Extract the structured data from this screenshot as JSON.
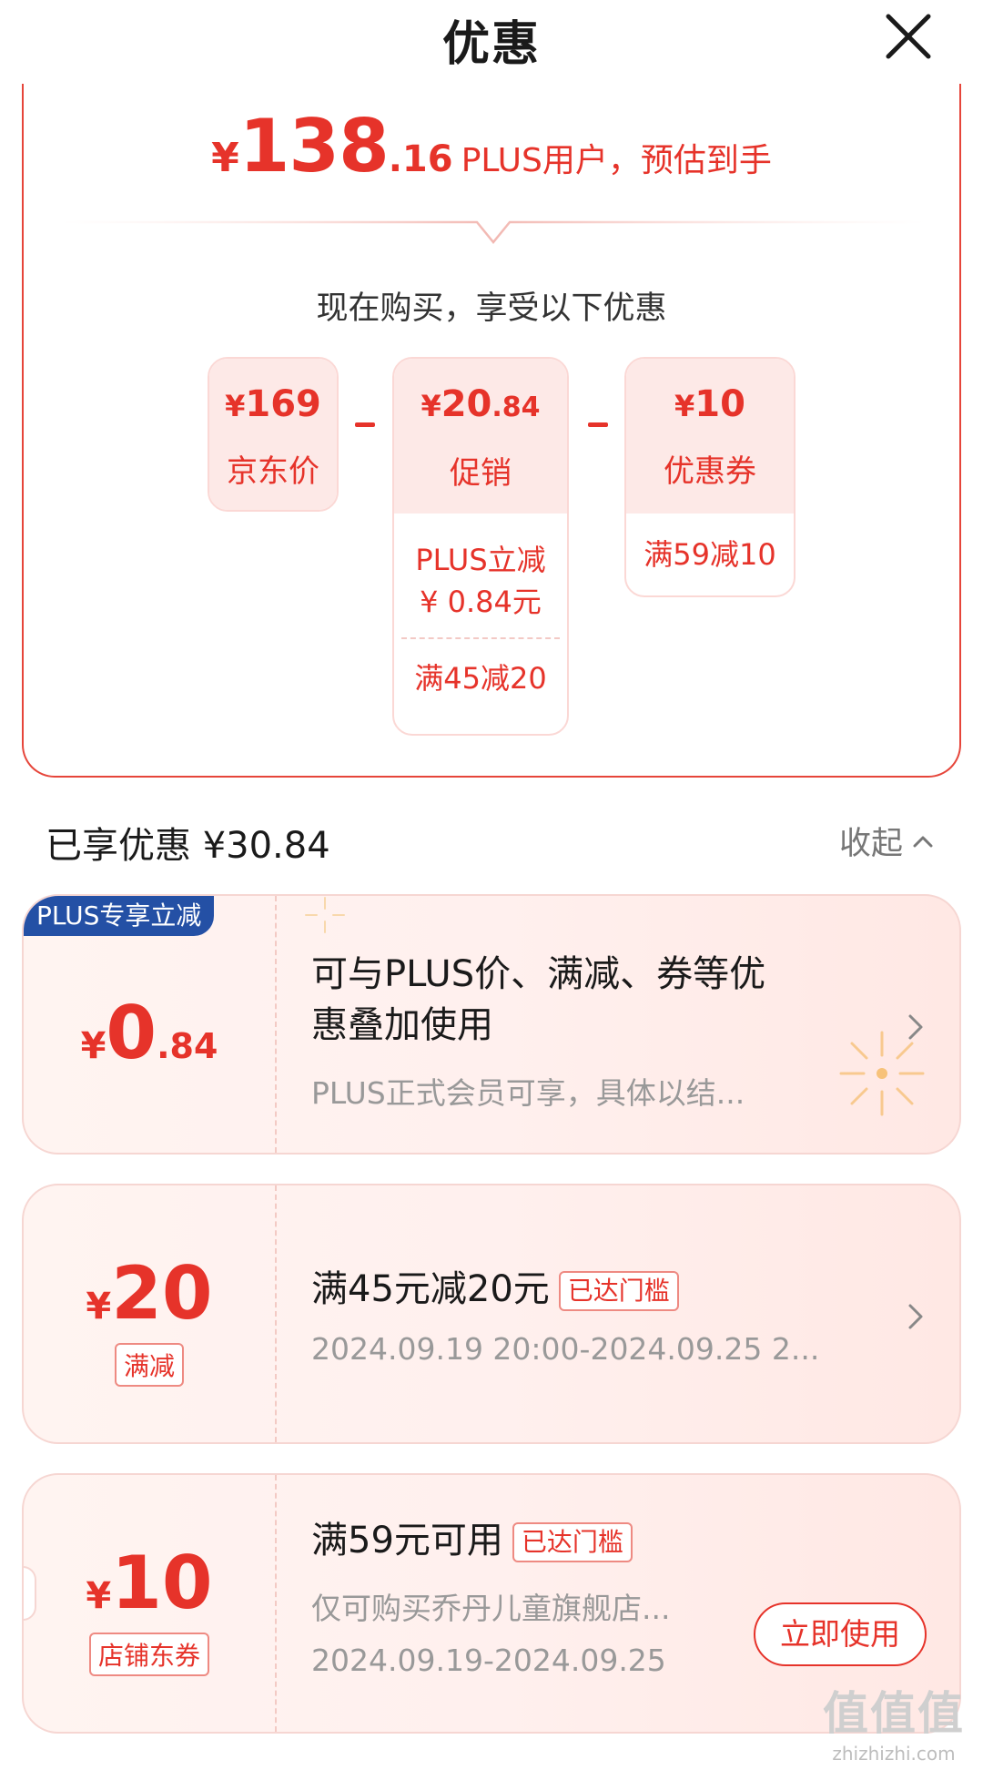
{
  "header": {
    "title": "优惠"
  },
  "summary": {
    "price_currency": "¥",
    "price_int": "138",
    "price_dec": ".16",
    "price_note": "PLUS用户，预估到手",
    "subtitle": "现在购买，享受以下优惠",
    "boxes": [
      {
        "currency": "¥",
        "amount": "169",
        "amount_dec": "",
        "label": "京东价"
      },
      {
        "currency": "¥",
        "amount": "20",
        "amount_dec": ".84",
        "label": "促销",
        "details": [
          "PLUS立减",
          "¥ 0.84元",
          "满45减20"
        ]
      },
      {
        "currency": "¥",
        "amount": "10",
        "amount_dec": "",
        "label": "优惠券",
        "details": [
          "满59减10"
        ]
      }
    ]
  },
  "enjoyed": {
    "label": "已享优惠 ¥30.84",
    "collapse_label": "收起"
  },
  "coupons": [
    {
      "badge": "PLUS专享立减",
      "currency": "¥",
      "amount": "0",
      "amount_dec": ".84",
      "title_line1": "可与PLUS价、满减、券等优",
      "title_line2": "惠叠加使用",
      "desc": "PLUS正式会员可享，具体以结..."
    },
    {
      "currency": "¥",
      "amount": "20",
      "tag": "满减",
      "title": "满45元减20元",
      "status": "已达门槛",
      "desc": "2024.09.19 20:00-2024.09.25 2..."
    },
    {
      "currency": "¥",
      "amount": "10",
      "tag": "店铺东券",
      "title": "满59元可用",
      "status": "已达门槛",
      "desc": "仅可购买乔丹儿童旗舰店...",
      "date": "2024.09.19-2024.09.25",
      "button": "立即使用"
    }
  ],
  "watermark": {
    "main": "值值值",
    "sub": "zhizhizhi.com"
  },
  "colors": {
    "accent": "#e6332a",
    "badge_blue": "#2450a5",
    "card_border": "#f6d6d2"
  },
  "icons": {
    "close": "close-icon",
    "chevron_up": "chevron-up-icon",
    "chevron_right": "chevron-right-icon"
  }
}
